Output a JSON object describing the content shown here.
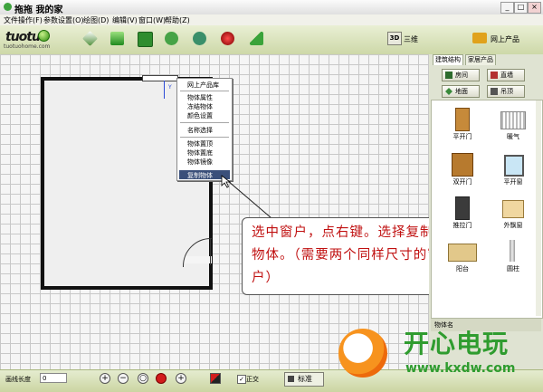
{
  "window": {
    "title": "拖拖 我的家",
    "minimize": "_",
    "maximize": "□",
    "close": "×"
  },
  "menu": [
    "文件操作(F)",
    "参数设置(O)",
    "绘图(D)",
    "编辑(V)",
    "窗口(W)",
    "帮助(Z)"
  ],
  "logo": {
    "text": "tuotuo",
    "url": "tuotuohome.com"
  },
  "toolbar": {
    "tools": [
      "cube-icon",
      "green-box-icon",
      "save-icon",
      "undo-icon",
      "redo-icon",
      "record-icon",
      "arrow-icon"
    ],
    "btn_3d": "3D",
    "label_3d": "三维",
    "online_products": "网上产品"
  },
  "canvas": {
    "axis_label": "Y"
  },
  "context_menu": {
    "items": [
      "网上产品库",
      "物体属性",
      "冻结物体",
      "颜色设置",
      "名称选择",
      "物体置顶",
      "物体置底",
      "物体镜像",
      "复制物体"
    ],
    "selected": "复制物体"
  },
  "callout": {
    "text": "选中窗户，点右键。选择复制物体。（需要两个同样尺寸的窗户）"
  },
  "side_panel": {
    "tabs": [
      "建筑结构",
      "家居产品"
    ],
    "active_tab": "建筑结构",
    "buttons": [
      "房间",
      "直墙",
      "地面",
      "吊顶"
    ],
    "items": [
      "平开门",
      "暖气",
      "双开门",
      "平开窗",
      "推拉门",
      "外飘窗",
      "阳台",
      "圆柱"
    ],
    "footer_label": "物体名"
  },
  "statusbar": {
    "line_length_label": "画线长度",
    "line_length_value": "0",
    "orthogonal_label": "正交",
    "orthogonal_checked": true,
    "standard_button": "标准"
  },
  "watermark": {
    "title": "开心电玩",
    "url": "www.kxdw.com"
  }
}
